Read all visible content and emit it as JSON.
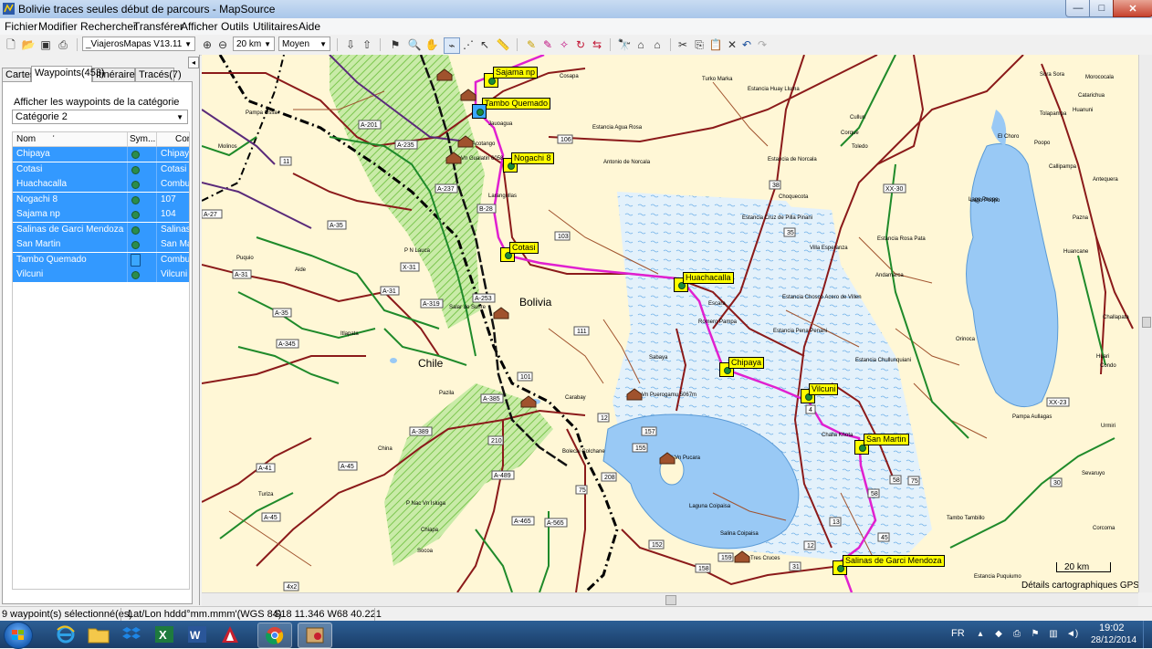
{
  "window": {
    "title": "Bolivie traces seules début de parcours - MapSource",
    "buttons": {
      "minimize": "—",
      "maximize": "□",
      "close": "✕"
    }
  },
  "menu": [
    "Fichier",
    "Modifier",
    "Rechercher",
    "Transférer",
    "Afficher",
    "Outils",
    "Utilitaires",
    "Aide"
  ],
  "toolbar": {
    "map_product": "_ViajerosMapas V13.11",
    "zoom_scale": "20 km",
    "detail_level": "Moyen"
  },
  "left_panel": {
    "tabs": [
      "Cartes",
      "Waypoints(453)",
      "Itinéraires",
      "Tracés(7)"
    ],
    "active_tab": "Waypoints(453)",
    "filter_label": "Afficher les waypoints de la catégorie",
    "category": "Catégorie 2",
    "columns": [
      "Nom",
      "Sym...",
      "Con"
    ],
    "waypoints": [
      {
        "name": "Chipaya",
        "symbol": "green-dot",
        "comment": "Chipaya"
      },
      {
        "name": "Cotasi",
        "symbol": "green-dot",
        "comment": "Cotasi"
      },
      {
        "name": "Huachacalla",
        "symbol": "green-dot",
        "comment": "Combus"
      },
      {
        "name": "Nogachi 8",
        "symbol": "green-dot",
        "comment": "107"
      },
      {
        "name": "Sajama np",
        "symbol": "green-dot",
        "comment": "104"
      },
      {
        "name": "Salinas de Garci Mendoza",
        "symbol": "green-dot",
        "comment": "Salinas"
      },
      {
        "name": "San Martin",
        "symbol": "green-dot",
        "comment": "San Mar"
      },
      {
        "name": "Tambo Quemado",
        "symbol": "fuel-pump",
        "comment": "Combus"
      },
      {
        "name": "Vilcuni",
        "symbol": "green-dot",
        "comment": "Vilcuni"
      }
    ]
  },
  "map": {
    "country_labels": [
      "Bolivia",
      "Chile"
    ],
    "waypoint_flags": [
      "Sajama np",
      "Tambo Quemado",
      "Nogachi 8",
      "Cotasi",
      "Huachacalla",
      "Chipaya",
      "Vilcuni",
      "San Martin",
      "Salinas de Garci Mendoza"
    ],
    "road_numbers": [
      "106",
      "11",
      "A-27",
      "A-201",
      "A-235",
      "A-237",
      "B-28",
      "A-35",
      "A-31",
      "X-31",
      "A-319",
      "A-253",
      "A-345",
      "103",
      "111",
      "101",
      "A-385",
      "A-389",
      "210",
      "12",
      "157",
      "155",
      "208",
      "75",
      "A-489",
      "A-465",
      "A-565",
      "152",
      "A-41",
      "A-45",
      "159",
      "158",
      "31",
      "12",
      "13",
      "45",
      "58",
      "58",
      "75",
      "30",
      "XX-30",
      "XX-23",
      "38",
      "35"
    ],
    "place_names": [
      "Cosapa",
      "Turko Marka",
      "Estancia Huay Lluma",
      "Estancia Agua Rosa",
      "Jauoagua",
      "Acotango",
      "Vn Gualatiri 6058",
      "Estancia de Norcala",
      "Antonio de Norcala",
      "Larangullas",
      "Estancia Cruz de Pilla Pinani",
      "Villa Esperanza",
      "Estancia Rosa Pata",
      "Andamarca",
      "Estancia Chosco Acero de Villen",
      "Estancia Pena Penani",
      "Estancia Chullunquiani",
      "Romero Pampa",
      "Escara",
      "Sabaya",
      "Vn Puerogamu 5067m",
      "Carabay",
      "Bolecai Colchane",
      "Vn Pucara",
      "Laguna Coipaisa",
      "Salina Coipaisa",
      "Tres Cruces",
      "Tambo Tambillo",
      "Estancia Puquiumo",
      "Challa Khota",
      "Pampa Aullagas",
      "Lago Poopo",
      "Poopo",
      "El Choro",
      "Challapata",
      "Huari",
      "Condo",
      "Urmiri",
      "Sevaruyo",
      "Corcoma",
      "Orinoca",
      "Pampa Ossa",
      "Molinos",
      "Puquio",
      "Aide",
      "P N Lauca",
      "Chile",
      "Itlapata",
      "Turiza",
      "China",
      "Chiapa",
      "Socoa",
      "Pazila",
      "P Nac Vn Isluga",
      "Salar de Surire",
      "Sora Sora",
      "Morococala",
      "Catarichua",
      "Tolapampa",
      "Huanuni",
      "Callipampa",
      "Antequera",
      "Pazna",
      "Huancane",
      "Lago Poopo",
      "Culluri",
      "Corque",
      "Toledo",
      "Choquecota"
    ],
    "scale_label": "20 km",
    "credit": "Détails cartographiques GPS"
  },
  "status": {
    "selection": "9 waypoint(s) sélectionné(es)",
    "coord_format": "Lat/Lon hddd°mm.mmm'(WGS 84)",
    "cursor_position": "S18 11.346 W68 40.221"
  },
  "taskbar": {
    "apps": [
      "Internet Explorer",
      "Explorateur Windows",
      "Dropbox",
      "Microsoft Excel",
      "Microsoft Word",
      "Autodesk",
      "Google Chrome",
      "MapSource"
    ],
    "language": "FR",
    "time": "19:02",
    "date": "28/12/2014"
  },
  "colors": {
    "map_background": "#fff7d6",
    "park_green": "#b9e39a",
    "water_blue": "#99c9f5",
    "route_magenta": "#e020d0",
    "road_brown": "#8b1a1a",
    "road_green": "#1f8a2a",
    "selection_blue": "#3399ff",
    "waypoint_yellow": "#ffff00"
  }
}
